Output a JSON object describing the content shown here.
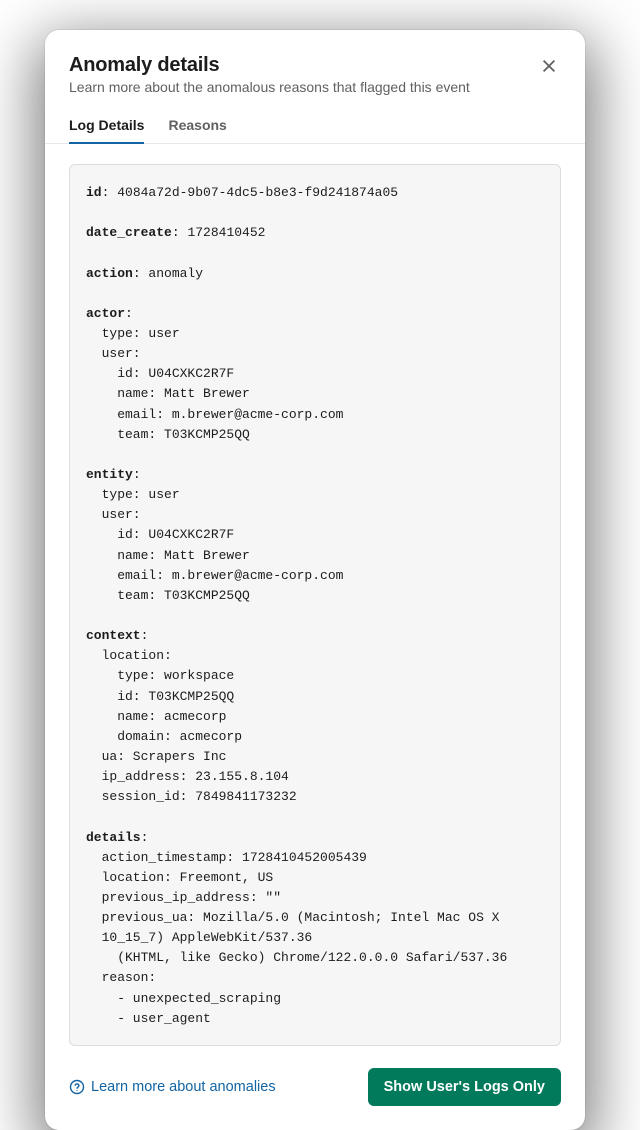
{
  "header": {
    "title": "Anomaly details",
    "subtitle": "Learn more about the anomalous reasons that flagged this event"
  },
  "tabs": {
    "log_details": "Log Details",
    "reasons": "Reasons"
  },
  "log": {
    "id_key": "id",
    "id": "4084a72d-9b07-4dc5-b8e3-f9d241874a05",
    "date_create_key": "date_create",
    "date_create": "1728410452",
    "action_key": "action",
    "action": "anomaly",
    "actor_key": "actor",
    "actor_type_line": "  type: user",
    "actor_user_line": "  user:",
    "actor_id_line": "    id: U04CXKC2R7F",
    "actor_name_line": "    name: Matt Brewer",
    "actor_email_line": "    email: m.brewer@acme-corp.com",
    "actor_team_line": "    team: T03KCMP25QQ",
    "entity_key": "entity",
    "entity_type_line": "  type: user",
    "entity_user_line": "  user:",
    "entity_id_line": "    id: U04CXKC2R7F",
    "entity_name_line": "    name: Matt Brewer",
    "entity_email_line": "    email: m.brewer@acme-corp.com",
    "entity_team_line": "    team: T03KCMP25QQ",
    "context_key": "context",
    "ctx_location_line": "  location:",
    "ctx_loc_type_line": "    type: workspace",
    "ctx_loc_id_line": "    id: T03KCMP25QQ",
    "ctx_loc_name_line": "    name: acmecorp",
    "ctx_loc_domain_line": "    domain: acmecorp",
    "ctx_ua_line": "  ua: Scrapers Inc",
    "ctx_ip_line": "  ip_address: 23.155.8.104",
    "ctx_session_line": "  session_id: 7849841173232",
    "details_key": "details",
    "det_ts_line": "  action_timestamp: 1728410452005439",
    "det_loc_line": "  location: Freemont, US",
    "det_prev_ip_line": "  previous_ip_address: \"\"",
    "det_prev_ua_line1": "  previous_ua: Mozilla/5.0 (Macintosh; Intel Mac OS X",
    "det_prev_ua_line2": "  10_15_7) AppleWebKit/537.36",
    "det_prev_ua_line3": "    (KHTML, like Gecko) Chrome/122.0.0.0 Safari/537.36",
    "det_reason_line": "  reason:",
    "det_reason1": "    - unexpected_scraping",
    "det_reason2": "    - user_agent"
  },
  "footer": {
    "learn_link": "Learn more about anomalies",
    "primary_button": "Show User's Logs Only"
  }
}
